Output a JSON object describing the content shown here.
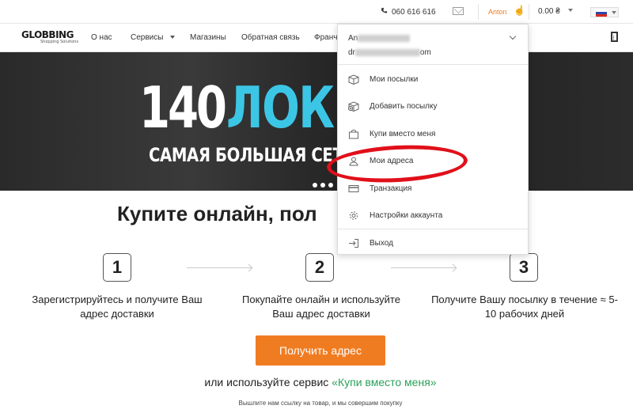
{
  "topbar": {
    "phone": "060 616 616",
    "user": "Anton",
    "balance": "0.00 ₴",
    "language": "RU"
  },
  "logo": {
    "name": "GLOBBING",
    "tagline": "Shopping Solutions"
  },
  "nav": {
    "items": [
      "О нас",
      "Сервисы",
      "Магазины",
      "Обратная связь",
      "Франч"
    ]
  },
  "hero": {
    "number": "140",
    "word": "ЛОКЕ",
    "slogan": "САМАЯ БОЛЬШАЯ СЕТЬ Л"
  },
  "main": {
    "headline": "Купите онлайн, пол",
    "steps": [
      {
        "number": "1",
        "text": "Зарегистрируйтесь и получите Ваш адрес доставки"
      },
      {
        "number": "2",
        "text": "Покупайте онлайн и используйте Ваш адрес доставки"
      },
      {
        "number": "3",
        "text": "Получите Вашу посылку в течение ≈ 5-10 рабочих дней"
      }
    ],
    "cta_label": "Получить адрес",
    "alt_text": "или используйте сервис ",
    "alt_link": "«Купи вместо меня»",
    "footnote": "Вышлите нам ссылку на товар, и мы совершим покупку"
  },
  "dropdown": {
    "name_visible": "An",
    "email_prefix": "dr",
    "email_suffix": "om",
    "items": [
      {
        "label": "Мои посылки",
        "icon": "box-icon"
      },
      {
        "label": "Добавить посылку",
        "icon": "add-box-icon"
      },
      {
        "label": "Купи вместо меня",
        "icon": "shopping-bag-icon"
      },
      {
        "label": "Мои адреса",
        "icon": "address-icon"
      },
      {
        "label": "Транзакция",
        "icon": "card-icon"
      },
      {
        "label": "Настройки аккаунта",
        "icon": "gear-icon"
      },
      {
        "label": "Выход",
        "icon": "logout-icon"
      }
    ]
  },
  "colors": {
    "accent": "#f07c22",
    "hero_accent": "#3cc6e6",
    "link": "#2aa15a",
    "highlight": "#e0101a"
  }
}
